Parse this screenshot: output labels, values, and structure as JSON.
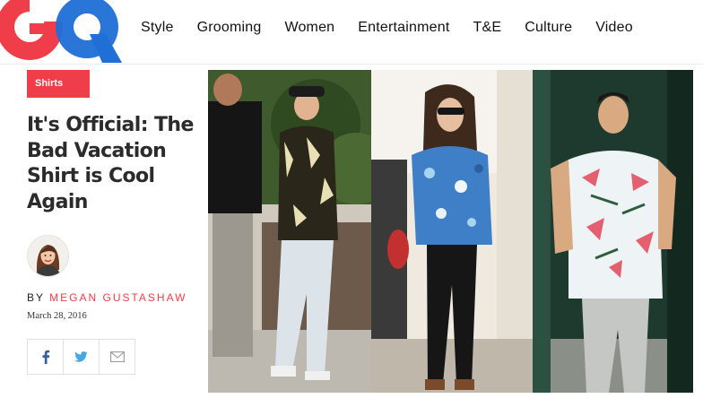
{
  "brand": {
    "logo_text": "GQ"
  },
  "nav": {
    "items": [
      "Style",
      "Grooming",
      "Women",
      "Entertainment",
      "T&E",
      "Culture",
      "Video"
    ]
  },
  "article": {
    "tag": "Shirts",
    "title": "It's Official: The Bad Vacation Shirt is Cool Again",
    "byline_prefix": "BY",
    "author": "MEGAN GUSTASHAW",
    "date": "March 28, 2016"
  },
  "share": {
    "icons": [
      "facebook-icon",
      "twitter-icon",
      "email-icon"
    ]
  },
  "colors": {
    "accent": "#ef3e4a",
    "logo_blue": "#1f6fd6",
    "logo_red": "#ef3e4a"
  }
}
